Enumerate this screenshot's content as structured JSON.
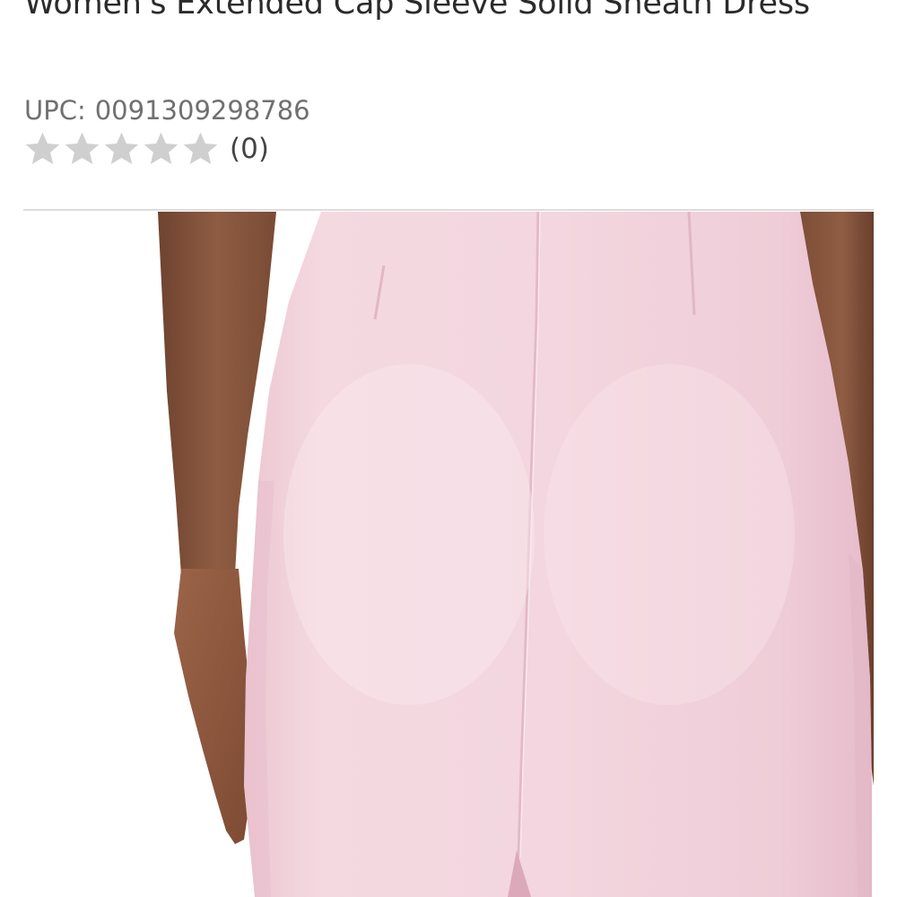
{
  "product": {
    "title": "Women's Extended Cap Sleeve Solid Sheath Dress",
    "upc_label": "UPC:",
    "upc_value": "0091309298786",
    "rating": {
      "stars_filled": 0,
      "stars_total": 5,
      "review_count": "(0)"
    },
    "image": {
      "subject": "back view of pink sheath dress",
      "dress_color": "#f2d4dd",
      "skin_color": "#8a5a3f"
    }
  },
  "colors": {
    "title_text": "#2b2b2b",
    "meta_text": "#707070",
    "star_empty": "#cfcfcf",
    "divider": "#dcdcdc"
  }
}
